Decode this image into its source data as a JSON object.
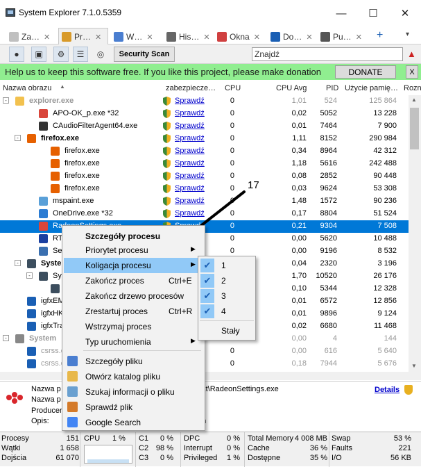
{
  "window": {
    "title": "System Explorer 7.1.0.5359"
  },
  "tabs": [
    {
      "label": "Za…",
      "color": "#c0c0c0"
    },
    {
      "label": "Pr…",
      "color": "#d89a2a"
    },
    {
      "label": "W…",
      "color": "#4a7ed0"
    },
    {
      "label": "His…",
      "color": "#666"
    },
    {
      "label": "Okna",
      "color": "#d04040"
    },
    {
      "label": "Do…",
      "color": "#1a5fb4"
    },
    {
      "label": "Pu…",
      "color": "#555"
    }
  ],
  "toolbar": {
    "scan_label": "Security Scan",
    "search_value": "Znajdź"
  },
  "donate": {
    "text": "Help us to keep this software free.  If you like this project, please make donation",
    "button": "DONATE",
    "close": "X"
  },
  "columns": {
    "name": "Nazwa obrazu",
    "security": "zabezpiecze…",
    "cpu": "CPU",
    "cpu_avg": "CPU Avg",
    "pid": "PID",
    "mem": "Użycie pamię…",
    "loc": "Rozn"
  },
  "rows": [
    {
      "name": "explorer.exe",
      "indent": 0,
      "tree": "-",
      "icon": "#f2c14e",
      "sk": "Sprawdź",
      "cpu": "0",
      "avg": "1,01",
      "pid": "524",
      "mem": "125 864",
      "grey": true,
      "bold": true
    },
    {
      "name": "APO-OK_p.exe *32",
      "indent": 2,
      "icon": "#d9463b",
      "sk": "Sprawdź",
      "cpu": "0",
      "avg": "0,02",
      "pid": "5052",
      "mem": "13 228"
    },
    {
      "name": "CAudioFilterAgent64.exe",
      "indent": 2,
      "icon": "#333",
      "sk": "Sprawdź",
      "cpu": "0",
      "avg": "0,01",
      "pid": "7464",
      "mem": "7 900"
    },
    {
      "name": "firefox.exe",
      "indent": 1,
      "tree": "-",
      "icon": "#e66000",
      "sk": "Sprawdź",
      "cpu": "0",
      "avg": "1,11",
      "pid": "8152",
      "mem": "290 984",
      "bold": true
    },
    {
      "name": "firefox.exe",
      "indent": 3,
      "icon": "#e66000",
      "sk": "Sprawdź",
      "cpu": "0",
      "avg": "0,34",
      "pid": "8964",
      "mem": "42 312"
    },
    {
      "name": "firefox.exe",
      "indent": 3,
      "icon": "#e66000",
      "sk": "Sprawdź",
      "cpu": "0",
      "avg": "1,18",
      "pid": "5616",
      "mem": "242 488"
    },
    {
      "name": "firefox.exe",
      "indent": 3,
      "icon": "#e66000",
      "sk": "Sprawdź",
      "cpu": "0",
      "avg": "0,08",
      "pid": "2852",
      "mem": "90 448"
    },
    {
      "name": "firefox.exe",
      "indent": 3,
      "icon": "#e66000",
      "sk": "Sprawdź",
      "cpu": "0",
      "avg": "0,03",
      "pid": "9624",
      "mem": "53 308"
    },
    {
      "name": "mspaint.exe",
      "indent": 2,
      "icon": "#5aa0d8",
      "sk": "Sprawdź",
      "cpu": "0",
      "avg": "1,48",
      "pid": "1572",
      "mem": "90 236"
    },
    {
      "name": "OneDrive.exe *32",
      "indent": 2,
      "icon": "#2b7cd3",
      "sk": "Sprawdź",
      "cpu": "0",
      "avg": "0,17",
      "pid": "8804",
      "mem": "51 524"
    },
    {
      "name": "RadeonSettings.exe",
      "indent": 2,
      "icon": "#d9463b",
      "sk": "Sprawdź",
      "cpu": "0",
      "avg": "0,21",
      "pid": "9304",
      "mem": "7 508",
      "sel": true
    },
    {
      "name": "RTFTrack.exe",
      "indent": 2,
      "icon": "#1a3fa0",
      "sk": "Sprawdź",
      "cpu": "0",
      "avg": "0,00",
      "pid": "5620",
      "mem": "10 488"
    },
    {
      "name": "SecurityHealthSystray.exe",
      "indent": 2,
      "icon": "#3a6fb0",
      "sk": "Sprawdź",
      "cpu": "0",
      "avg": "0,00",
      "pid": "9196",
      "mem": "8 532"
    },
    {
      "name": "SystemExplorer.exe",
      "indent": 1,
      "tree": "-",
      "icon": "#3c4e5e",
      "sk": "Sprawdź",
      "cpu": "0",
      "avg": "0,04",
      "pid": "2320",
      "mem": "3 196",
      "bold": true
    },
    {
      "name": "SystemExplorerService64.exe",
      "indent": 2,
      "tree": "-",
      "icon": "#3c4e5e",
      "sk": "Sprawdź",
      "cpu": "0",
      "avg": "1,70",
      "pid": "10520",
      "mem": "26 176"
    },
    {
      "name": "SystemExplorer.exe",
      "indent": 3,
      "icon": "#3c4e5e",
      "sk": "Sprawdź",
      "cpu": "0",
      "avg": "0,10",
      "pid": "5344",
      "mem": "12 328"
    },
    {
      "name": "igfxEM.exe",
      "indent": 1,
      "icon": "#1a5fb4",
      "sk": "Sprawdź",
      "cpu": "0",
      "avg": "0,01",
      "pid": "6572",
      "mem": "12 856"
    },
    {
      "name": "igfxHK.exe",
      "indent": 1,
      "icon": "#1a5fb4",
      "sk": "Sprawdź",
      "cpu": "0",
      "avg": "0,01",
      "pid": "9896",
      "mem": "9 124"
    },
    {
      "name": "igfxTray.exe",
      "indent": 1,
      "icon": "#1a5fb4",
      "sk": "Sprawdź",
      "cpu": "0",
      "avg": "0,02",
      "pid": "6680",
      "mem": "11 468"
    },
    {
      "name": "System",
      "indent": 0,
      "tree": "-",
      "icon": "#888",
      "sk": "",
      "cpu": "",
      "avg": "0,00",
      "pid": "4",
      "mem": "144",
      "grey": true,
      "bold": true
    },
    {
      "name": "csrss.exe",
      "indent": 1,
      "icon": "#1a5fb4",
      "sk": "Sprawdź",
      "cpu": "0",
      "avg": "0,00",
      "pid": "616",
      "mem": "5 640",
      "grey": true
    },
    {
      "name": "csrss.exe",
      "indent": 1,
      "icon": "#1a5fb4",
      "sk": "Sprawdź",
      "cpu": "0",
      "avg": "0,18",
      "pid": "7944",
      "mem": "5 676",
      "grey": true
    }
  ],
  "annotation": {
    "label": "17"
  },
  "details": {
    "name_label": "Nazwa p",
    "name_label2": "Nazwa p",
    "producer_label": "Producer",
    "desc_label": "Opis:",
    "path_tail": "ext\\RadeonSettings.exe",
    "tail2": "on",
    "details_link": "Details"
  },
  "status": {
    "procs_label": "Procesy",
    "procs": "151",
    "threads_label": "Wątki",
    "threads": "1 658",
    "handles_label": "Dojścia",
    "handles": "61 070",
    "cpu_label": "CPU",
    "cpu": "1 %",
    "c1": "C1",
    "c1v": "0 %",
    "c2": "C2",
    "c2v": "98 %",
    "c3": "C3",
    "c3v": "0 %",
    "dpc": "DPC",
    "dpcv": "0 %",
    "intr": "Interrupt",
    "intrv": "0 %",
    "priv": "Privileged",
    "privv": "1 %",
    "tm": "Total Memory",
    "tmv": "4 008 MB",
    "cache": "Cache",
    "cachev": "36 %",
    "avail": "Dostępne",
    "availv": "35 %",
    "swap": "Swap",
    "swapv": "53 %",
    "faults": "Faults",
    "faultsv": "221",
    "io": "I/O",
    "iov": "56 KB"
  },
  "context_menu": [
    {
      "label": "Szczegóły procesu",
      "bold": true
    },
    {
      "label": "Priorytet procesu",
      "arrow": true
    },
    {
      "label": "Koligacja procesu",
      "arrow": true,
      "hl": true
    },
    {
      "label": "Zakończ proces",
      "shortcut": "Ctrl+E"
    },
    {
      "label": "Zakończ drzewo procesów"
    },
    {
      "label": "Zrestartuj proces",
      "shortcut": "Ctrl+R"
    },
    {
      "label": "Wstrzymaj proces"
    },
    {
      "label": "Typ uruchomienia",
      "arrow": true
    },
    {
      "label": "Szczegóły pliku",
      "icon": "#4a7ed0"
    },
    {
      "label": "Otwórz katalog pliku",
      "icon": "#e8b84a"
    },
    {
      "label": "Szukaj informacji o pliku",
      "icon": "#6aa0d0"
    },
    {
      "label": "Sprawdź plik",
      "icon": "#d47a2a"
    },
    {
      "label": "Google Search",
      "icon": "#4285f4"
    }
  ],
  "submenu": [
    {
      "label": "1",
      "checked": true
    },
    {
      "label": "2",
      "checked": true
    },
    {
      "label": "3",
      "checked": true
    },
    {
      "label": "4",
      "checked": true
    },
    {
      "label": "Stały",
      "checked": false
    }
  ]
}
